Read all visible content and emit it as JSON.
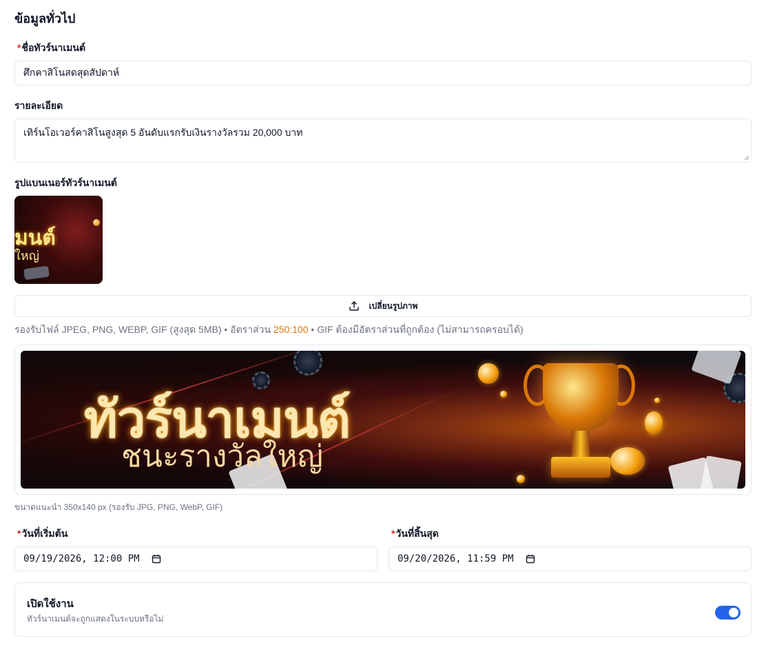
{
  "section": {
    "title": "ข้อมูลทั่วไป"
  },
  "name_field": {
    "required_mark": "*",
    "label": "ชื่อทัวร์นาเมนต์",
    "value": "ศึกคาสิโนสดสุดสัปดาห์"
  },
  "description_field": {
    "label": "รายละเอียด",
    "value": "เทิร์นโอเวอร์คาสิโนสูงสุด 5 อันดับแรกรับเงินรางวัลรวม 20,000 บาท"
  },
  "banner_field": {
    "label": "รูปแบนเนอร์ทัวร์นาเมนต์",
    "thumb_text_line1": "มนต์",
    "thumb_text_line2": "ใหญ่",
    "upload_label": "เปลี่ยนรูปภาพ",
    "upload_icon": "upload-icon",
    "hint_prefix": "รองรับไฟล์ JPEG, PNG, WEBP, GIF (สูงสุด 5MB) • อัตราส่วน ",
    "hint_ratio": "250:100",
    "hint_suffix": " • GIF ต้องมีอัตราส่วนที่ถูกต้อง (ไม่สามารถครอบได้)",
    "preview_title": "ทัวร์นาเมนต์",
    "preview_subtitle": "ชนะรางวัลใหญ่",
    "size_note": "ขนาดแนะนำ 350x140 px (รองรับ JPG, PNG, WebP, GIF)"
  },
  "start_date": {
    "required_mark": "*",
    "label": "วันที่เริ่มต้น",
    "value": "09/19/2026, 12:00 PM"
  },
  "end_date": {
    "required_mark": "*",
    "label": "วันที่สิ้นสุด",
    "value": "09/20/2026, 11:59 PM"
  },
  "active_toggle": {
    "title": "เปิดใช้งาน",
    "description": "ทัวร์นาเมนต์จะถูกแสดงในระบบหรือไม่",
    "checked": true
  },
  "colors": {
    "accent": "#2563eb",
    "required": "#dc2626",
    "ratio": "#d97706"
  }
}
